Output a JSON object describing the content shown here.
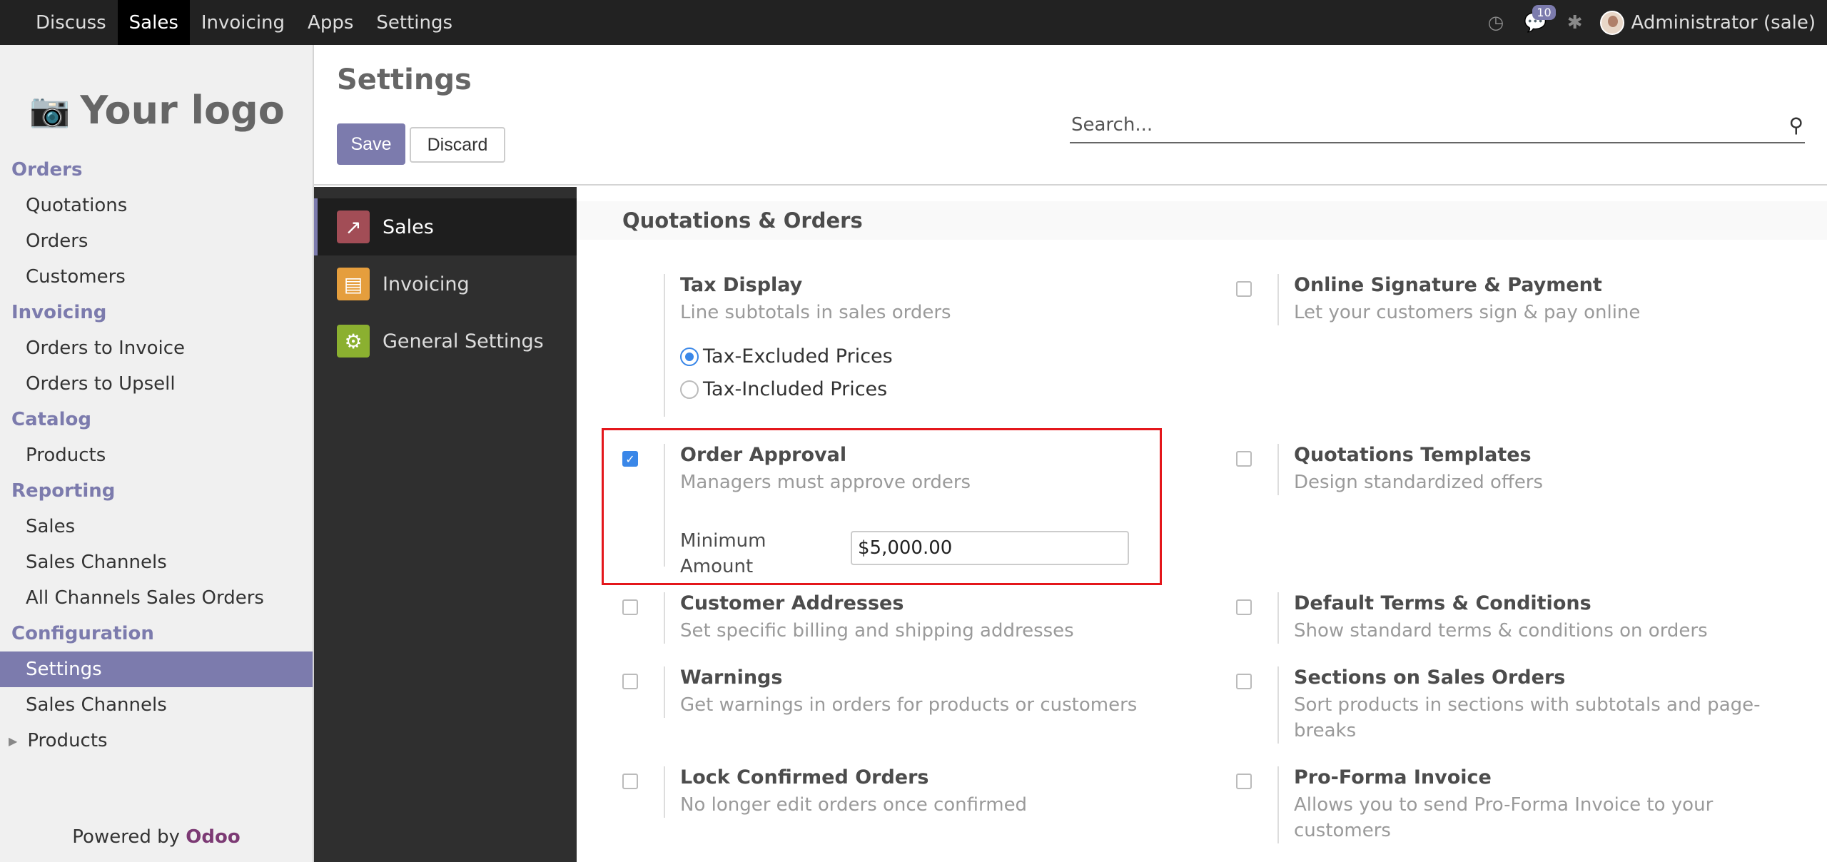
{
  "topbar": {
    "menu": [
      "Discuss",
      "Sales",
      "Invoicing",
      "Apps",
      "Settings"
    ],
    "active": "Sales",
    "notification_count": "10",
    "user": "Administrator (sale)",
    "icons": [
      "clock-icon",
      "chat-icon",
      "bug-icon"
    ]
  },
  "sidebar": {
    "logo_text": "Your logo",
    "sections": [
      {
        "title": "Orders",
        "items": [
          "Quotations",
          "Orders",
          "Customers"
        ]
      },
      {
        "title": "Invoicing",
        "items": [
          "Orders to Invoice",
          "Orders to Upsell"
        ]
      },
      {
        "title": "Catalog",
        "items": [
          "Products"
        ]
      },
      {
        "title": "Reporting",
        "items": [
          "Sales",
          "Sales Channels",
          "All Channels Sales Orders"
        ]
      },
      {
        "title": "Configuration",
        "items": [
          "Settings",
          "Sales Channels",
          "Products"
        ]
      }
    ],
    "active_item": "Settings",
    "powered_by": "Powered by",
    "powered_brand": "Odoo"
  },
  "control_panel": {
    "title": "Settings",
    "save_label": "Save",
    "discard_label": "Discard",
    "search_placeholder": "Search..."
  },
  "apps": [
    {
      "label": "Sales",
      "icon": "sales-chart-icon",
      "active": true
    },
    {
      "label": "Invoicing",
      "icon": "invoice-document-icon",
      "active": false
    },
    {
      "label": "General Settings",
      "icon": "gear-icon",
      "active": false
    }
  ],
  "settings": {
    "section_title": "Quotations & Orders",
    "tax_display": {
      "title": "Tax Display",
      "desc": "Line subtotals in sales orders",
      "options": [
        "Tax-Excluded Prices",
        "Tax-Included Prices"
      ],
      "selected": "Tax-Excluded Prices"
    },
    "online_signature": {
      "title": "Online Signature & Payment",
      "desc": "Let your customers sign & pay online",
      "checked": false
    },
    "order_approval": {
      "title": "Order Approval",
      "desc": "Managers must approve orders",
      "checked": true,
      "min_label_1": "Minimum",
      "min_label_2": "Amount",
      "min_value": "$5,000.00"
    },
    "quotation_templates": {
      "title": "Quotations Templates",
      "desc": "Design standardized offers",
      "checked": false
    },
    "customer_addresses": {
      "title": "Customer Addresses",
      "desc": "Set specific billing and shipping addresses",
      "checked": false
    },
    "default_terms": {
      "title": "Default Terms & Conditions",
      "desc": "Show standard terms & conditions on orders",
      "checked": false
    },
    "warnings": {
      "title": "Warnings",
      "desc": "Get warnings in orders for products or customers",
      "checked": false
    },
    "sections_on_orders": {
      "title": "Sections on Sales Orders",
      "desc_1": "Sort products in sections with subtotals and page-",
      "desc_2": "breaks",
      "checked": false
    },
    "lock_confirmed": {
      "title": "Lock Confirmed Orders",
      "desc": "No longer edit orders once confirmed",
      "checked": false
    },
    "proforma": {
      "title": "Pro-Forma Invoice",
      "desc_1": "Allows you to send Pro-Forma Invoice to your",
      "desc_2": "customers",
      "checked": false
    }
  },
  "colors": {
    "accent": "#7c7bad",
    "checkbox": "#3a87e8",
    "highlight": "#e4161b"
  }
}
